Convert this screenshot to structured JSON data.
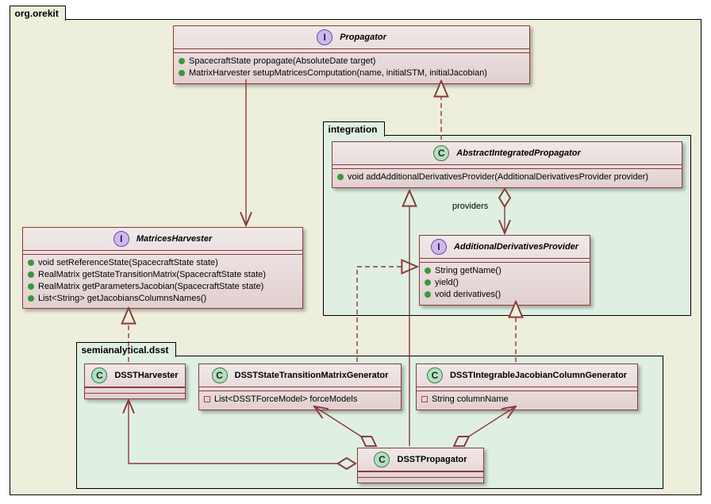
{
  "packages": {
    "outer": "org.orekit",
    "integration": "integration",
    "dsst": "semianalytical.dsst"
  },
  "classes": {
    "propagator": {
      "stereotype": "I",
      "name": "Propagator",
      "members": [
        "SpacecraftState propagate(AbsoluteDate target)",
        "MatrixHarvester setupMatricesComputation(name, initialSTM, initialJacobian)"
      ]
    },
    "abstractIntegrated": {
      "stereotype": "C",
      "name": "AbstractIntegratedPropagator",
      "members": [
        "void addAdditionalDerivativesProvider(AdditionalDerivativesProvider provider)"
      ]
    },
    "matricesHarvester": {
      "stereotype": "I",
      "name": "MatricesHarvester",
      "members": [
        "void setReferenceState(SpacecraftState state)",
        "RealMatrix getStateTransitionMatrix(SpacecraftState state)",
        "RealMatrix getParametersJacobian(SpacecraftState state)",
        "List<String> getJacobiansColumnsNames()"
      ]
    },
    "addlDerivProvider": {
      "stereotype": "I",
      "name": "AdditionalDerivativesProvider",
      "members": [
        "String getName()",
        "yield()",
        "void derivatives()"
      ]
    },
    "dsstHarvester": {
      "stereotype": "C",
      "name": "DSSTHarvester"
    },
    "dsstStm": {
      "stereotype": "C",
      "name": "DSSTStateTransitionMatrixGenerator",
      "members": [
        "List<DSSTForceModel> forceModels"
      ]
    },
    "dsstJac": {
      "stereotype": "C",
      "name": "DSSTIntegrableJacobianColumnGenerator",
      "members": [
        "String columnName"
      ]
    },
    "dsstProp": {
      "stereotype": "C",
      "name": "DSSTPropagator"
    }
  },
  "labels": {
    "providers": "providers"
  },
  "chart_data": {
    "type": "uml-class-diagram",
    "packages": [
      {
        "name": "org.orekit",
        "children": [
          "integration",
          "semianalytical.dsst"
        ]
      },
      {
        "name": "integration",
        "parent": "org.orekit"
      },
      {
        "name": "semianalytical.dsst",
        "parent": "org.orekit"
      }
    ],
    "classes": [
      {
        "id": "Propagator",
        "kind": "interface",
        "package": "org.orekit",
        "ops": [
          "SpacecraftState propagate(AbsoluteDate target)",
          "MatrixHarvester setupMatricesComputation(name, initialSTM, initialJacobian)"
        ]
      },
      {
        "id": "AbstractIntegratedPropagator",
        "kind": "class",
        "package": "integration",
        "ops": [
          "void addAdditionalDerivativesProvider(AdditionalDerivativesProvider provider)"
        ]
      },
      {
        "id": "MatricesHarvester",
        "kind": "interface",
        "package": "org.orekit",
        "ops": [
          "void setReferenceState(SpacecraftState state)",
          "RealMatrix getStateTransitionMatrix(SpacecraftState state)",
          "RealMatrix getParametersJacobian(SpacecraftState state)",
          "List<String> getJacobiansColumnsNames()"
        ]
      },
      {
        "id": "AdditionalDerivativesProvider",
        "kind": "interface",
        "package": "integration",
        "ops": [
          "String getName()",
          "yield()",
          "void derivatives()"
        ]
      },
      {
        "id": "DSSTHarvester",
        "kind": "class",
        "package": "semianalytical.dsst"
      },
      {
        "id": "DSSTStateTransitionMatrixGenerator",
        "kind": "class",
        "package": "semianalytical.dsst",
        "attrs": [
          "List<DSSTForceModel> forceModels"
        ]
      },
      {
        "id": "DSSTIntegrableJacobianColumnGenerator",
        "kind": "class",
        "package": "semianalytical.dsst",
        "attrs": [
          "String columnName"
        ]
      },
      {
        "id": "DSSTPropagator",
        "kind": "class",
        "package": "semianalytical.dsst"
      }
    ],
    "relations": [
      {
        "from": "Propagator",
        "to": "MatricesHarvester",
        "type": "create",
        "style": "solid-open-arrow"
      },
      {
        "from": "AbstractIntegratedPropagator",
        "to": "Propagator",
        "type": "realization",
        "style": "dashed-hollow-arrow"
      },
      {
        "from": "AbstractIntegratedPropagator",
        "to": "AdditionalDerivativesProvider",
        "type": "aggregation",
        "label": "providers",
        "style": "hollow-diamond"
      },
      {
        "from": "DSSTHarvester",
        "to": "MatricesHarvester",
        "type": "realization",
        "style": "dashed-hollow-arrow"
      },
      {
        "from": "DSSTStateTransitionMatrixGenerator",
        "to": "AdditionalDerivativesProvider",
        "type": "realization",
        "style": "dashed-hollow-arrow"
      },
      {
        "from": "DSSTIntegrableJacobianColumnGenerator",
        "to": "AdditionalDerivativesProvider",
        "type": "realization",
        "style": "dashed-hollow-arrow"
      },
      {
        "from": "DSSTPropagator",
        "to": "AbstractIntegratedPropagator",
        "type": "generalization",
        "style": "solid-hollow-arrow"
      },
      {
        "from": "DSSTPropagator",
        "to": "DSSTHarvester",
        "type": "aggregation",
        "style": "hollow-diamond"
      },
      {
        "from": "DSSTPropagator",
        "to": "DSSTStateTransitionMatrixGenerator",
        "type": "aggregation",
        "style": "hollow-diamond"
      },
      {
        "from": "DSSTPropagator",
        "to": "DSSTIntegrableJacobianColumnGenerator",
        "type": "aggregation",
        "style": "hollow-diamond"
      }
    ]
  }
}
